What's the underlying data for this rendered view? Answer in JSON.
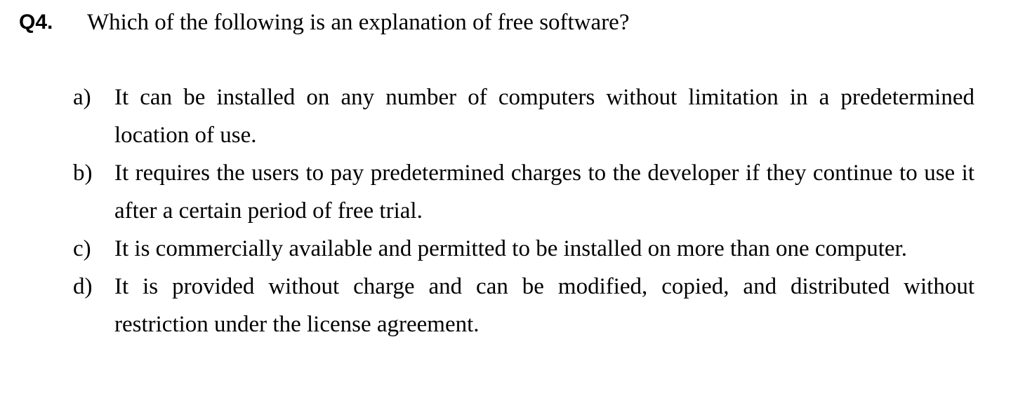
{
  "question": {
    "number": "Q4.",
    "text": "Which of the following is an explanation of free software?"
  },
  "options": [
    {
      "letter": "a)",
      "text": "It can be installed on any number of computers without limitation in a predetermined location of use."
    },
    {
      "letter": "b)",
      "text": "It requires the users to pay predetermined charges to the developer if they continue to use it after a certain period of free trial."
    },
    {
      "letter": "c)",
      "text": "It is commercially available and permitted to be installed on more than one computer."
    },
    {
      "letter": "d)",
      "text": "It is provided without charge and can be modified, copied, and distributed without restriction under the license agreement."
    }
  ]
}
